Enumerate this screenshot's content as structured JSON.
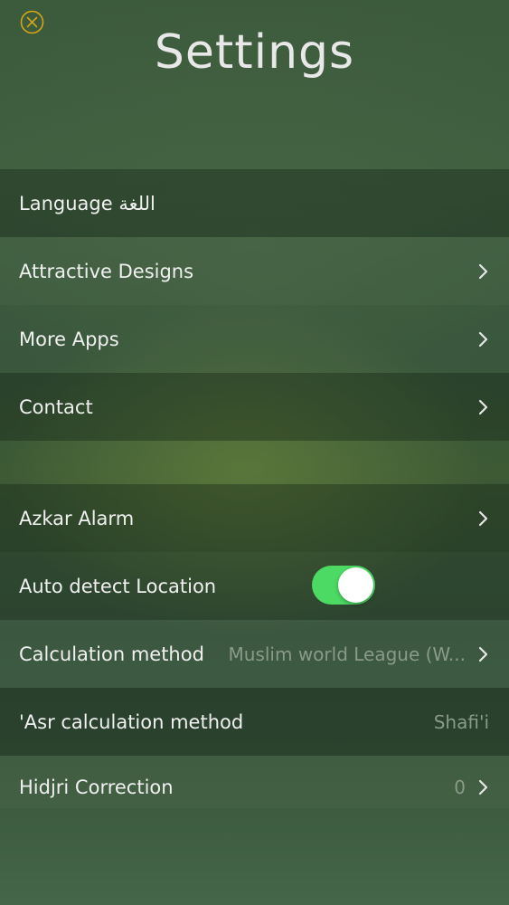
{
  "header": {
    "title": "Settings",
    "close_icon": "close-circle-icon",
    "close_color": "#d6a419"
  },
  "general": {
    "items": [
      {
        "label": "Language اللغة"
      },
      {
        "label": "Attractive Designs"
      },
      {
        "label": "More Apps"
      },
      {
        "label": "Contact"
      }
    ]
  },
  "prayer": {
    "azkar_alarm": {
      "label": "Azkar Alarm"
    },
    "auto_detect": {
      "label": "Auto detect Location",
      "enabled": true,
      "toggle_color": "#4cd964"
    },
    "calculation_method": {
      "label": "Calculation method",
      "value": "Muslim world League (W..."
    },
    "asr_method": {
      "label": "'Asr calculation method",
      "value": "Shafi'i"
    },
    "hijri_correction": {
      "label": "Hidjri Correction",
      "value": "0"
    }
  },
  "icons": {
    "chevron": "chevron-right-icon"
  }
}
